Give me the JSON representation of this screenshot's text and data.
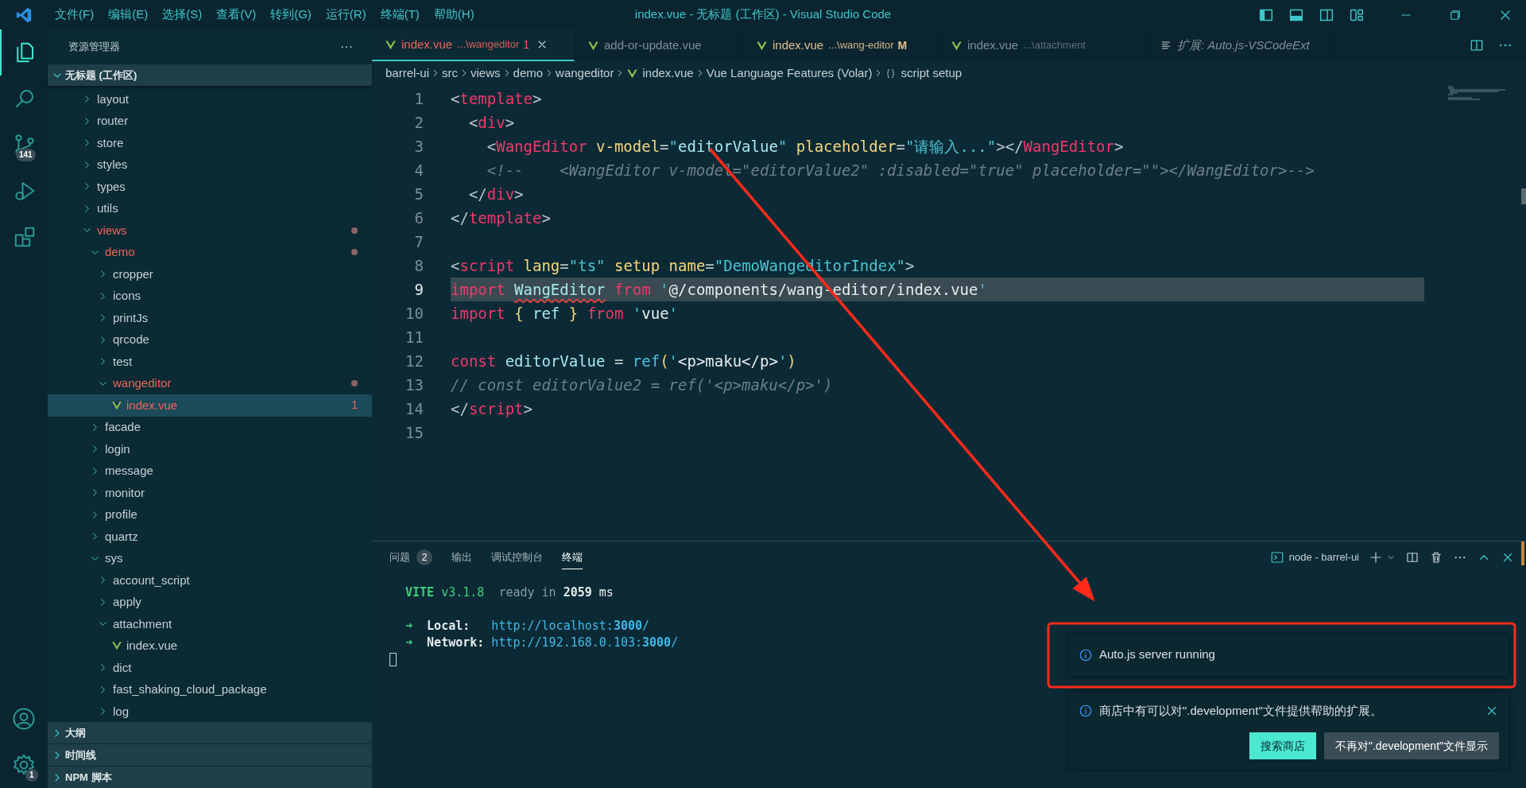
{
  "window": {
    "title": "index.vue - 无标题 (工作区) - Visual Studio Code"
  },
  "menu": [
    "文件(F)",
    "编辑(E)",
    "选择(S)",
    "查看(V)",
    "转到(G)",
    "运行(R)",
    "终端(T)",
    "帮助(H)"
  ],
  "activity_bar": [
    {
      "kind": "files",
      "selected": true
    },
    {
      "kind": "search",
      "selected": false
    },
    {
      "kind": "source-control",
      "selected": false,
      "badge": "141"
    },
    {
      "kind": "run",
      "selected": false
    },
    {
      "kind": "extensions",
      "selected": false
    }
  ],
  "activity_bar_bottom": [
    {
      "kind": "account"
    },
    {
      "kind": "settings",
      "badge": "1"
    }
  ],
  "sidebar": {
    "title": "资源管理器",
    "more": "···",
    "workspace": {
      "label": "无标题 (工作区)",
      "expanded": true
    },
    "tree": [
      {
        "label": "layout",
        "kind": "folder",
        "expanded": false,
        "modified": false,
        "selected": false
      },
      {
        "label": "router",
        "kind": "folder",
        "expanded": false,
        "modified": false,
        "selected": false
      },
      {
        "label": "store",
        "kind": "folder",
        "expanded": false,
        "modified": false,
        "selected": false
      },
      {
        "label": "styles",
        "kind": "folder",
        "expanded": false,
        "modified": false,
        "selected": false
      },
      {
        "label": "types",
        "kind": "folder",
        "expanded": false,
        "modified": false,
        "selected": false
      },
      {
        "label": "utils",
        "kind": "folder",
        "expanded": false,
        "modified": false,
        "selected": false
      },
      {
        "label": "views",
        "kind": "folder",
        "expanded": true,
        "modified": true,
        "selected": false,
        "children": [
          {
            "label": "demo",
            "kind": "folder",
            "expanded": true,
            "modified": true,
            "selected": false,
            "children": [
              {
                "label": "cropper",
                "kind": "folder",
                "expanded": false,
                "modified": false,
                "selected": false
              },
              {
                "label": "icons",
                "kind": "folder",
                "expanded": false,
                "modified": false,
                "selected": false
              },
              {
                "label": "printJs",
                "kind": "folder",
                "expanded": false,
                "modified": false,
                "selected": false
              },
              {
                "label": "qrcode",
                "kind": "folder",
                "expanded": false,
                "modified": false,
                "selected": false
              },
              {
                "label": "test",
                "kind": "folder",
                "expanded": false,
                "modified": false,
                "selected": false
              },
              {
                "label": "wangeditor",
                "kind": "folder",
                "expanded": true,
                "modified": true,
                "selected": false,
                "children": [
                  {
                    "label": "index.vue",
                    "kind": "vue",
                    "modified": true,
                    "selected": true,
                    "problems": "1"
                  }
                ]
              }
            ]
          },
          {
            "label": "facade",
            "kind": "folder",
            "expanded": false,
            "modified": false,
            "selected": false
          },
          {
            "label": "login",
            "kind": "folder",
            "expanded": false,
            "modified": false,
            "selected": false
          },
          {
            "label": "message",
            "kind": "folder",
            "expanded": false,
            "modified": false,
            "selected": false
          },
          {
            "label": "monitor",
            "kind": "folder",
            "expanded": false,
            "modified": false,
            "selected": false
          },
          {
            "label": "profile",
            "kind": "folder",
            "expanded": false,
            "modified": false,
            "selected": false
          },
          {
            "label": "quartz",
            "kind": "folder",
            "expanded": false,
            "modified": false,
            "selected": false
          },
          {
            "label": "sys",
            "kind": "folder",
            "expanded": true,
            "modified": false,
            "selected": false,
            "children": [
              {
                "label": "account_script",
                "kind": "folder",
                "expanded": false,
                "modified": false,
                "selected": false
              },
              {
                "label": "apply",
                "kind": "folder",
                "expanded": false,
                "modified": false,
                "selected": false
              },
              {
                "label": "attachment",
                "kind": "folder",
                "expanded": true,
                "modified": false,
                "selected": false,
                "children": [
                  {
                    "label": "index.vue",
                    "kind": "vue",
                    "modified": false,
                    "selected": false
                  }
                ]
              },
              {
                "label": "dict",
                "kind": "folder",
                "expanded": false,
                "modified": false,
                "selected": false
              },
              {
                "label": "fast_shaking_cloud_package",
                "kind": "folder",
                "expanded": false,
                "modified": false,
                "selected": false
              },
              {
                "label": "log",
                "kind": "folder",
                "expanded": false,
                "modified": false,
                "selected": false
              }
            ]
          }
        ]
      }
    ],
    "sections": [
      {
        "label": "大纲",
        "expanded": false
      },
      {
        "label": "时间线",
        "expanded": false
      },
      {
        "label": "NPM 脚本",
        "expanded": false
      }
    ]
  },
  "tabs": [
    {
      "name": "index.vue",
      "path": "...\\wangeditor",
      "status_letter": "1",
      "kind": "vue",
      "has_error": true,
      "modified": false,
      "selected": true,
      "preview": false
    },
    {
      "name": "add-or-update.vue",
      "kind": "vue",
      "has_error": false,
      "modified": false,
      "selected": false,
      "preview": false
    },
    {
      "name": "index.vue",
      "path": "...\\wang-editor",
      "status_letter": "M",
      "kind": "vue",
      "has_error": false,
      "modified": true,
      "selected": false,
      "preview": false
    },
    {
      "name": "index.vue",
      "path": "...\\attachment",
      "kind": "vue",
      "has_error": false,
      "modified": false,
      "selected": false,
      "preview": false
    },
    {
      "name": "扩展: Auto.js-VSCodeExt",
      "kind": "preview",
      "has_error": false,
      "modified": false,
      "selected": false,
      "preview": true
    }
  ],
  "breadcrumb": [
    {
      "label": "barrel-ui",
      "kind": "folder"
    },
    {
      "label": "src",
      "kind": "folder"
    },
    {
      "label": "views",
      "kind": "folder"
    },
    {
      "label": "demo",
      "kind": "folder"
    },
    {
      "label": "wangeditor",
      "kind": "folder"
    },
    {
      "label": "index.vue",
      "kind": "vue"
    },
    {
      "label": "Vue Language Features (Volar)",
      "kind": "folder"
    },
    {
      "label": "script setup",
      "kind": "symbol"
    }
  ],
  "code": [
    {
      "number": "1",
      "highlighted": false,
      "tokens": [
        {
          "text": "<",
          "kind": "punct"
        },
        {
          "text": "template",
          "kind": "tag"
        },
        {
          "text": ">",
          "kind": "punct"
        }
      ]
    },
    {
      "number": "2",
      "highlighted": false,
      "tokens": [
        {
          "text": "  <",
          "kind": "punct"
        },
        {
          "text": "div",
          "kind": "tag"
        },
        {
          "text": ">",
          "kind": "punct"
        }
      ]
    },
    {
      "number": "3",
      "highlighted": false,
      "tokens": [
        {
          "text": "    <",
          "kind": "punct"
        },
        {
          "text": "WangEditor",
          "kind": "tag"
        },
        {
          "text": " v-model",
          "kind": "attr"
        },
        {
          "text": "=",
          "kind": "punct"
        },
        {
          "text": "\"",
          "kind": "string"
        },
        {
          "text": "editorValue",
          "kind": "var"
        },
        {
          "text": "\"",
          "kind": "string"
        },
        {
          "text": " placeholder",
          "kind": "attr"
        },
        {
          "text": "=",
          "kind": "punct"
        },
        {
          "text": "\"请输入...\"",
          "kind": "string"
        },
        {
          "text": "></",
          "kind": "punct"
        },
        {
          "text": "WangEditor",
          "kind": "tag"
        },
        {
          "text": ">",
          "kind": "punct"
        }
      ]
    },
    {
      "number": "4",
      "highlighted": false,
      "tokens": [
        {
          "text": "    <!--    <WangEditor v-model=\"editorValue2\" :disabled=\"true\" placeholder=\"\"></WangEditor>-->",
          "kind": "comment"
        }
      ]
    },
    {
      "number": "5",
      "highlighted": false,
      "tokens": [
        {
          "text": "  </",
          "kind": "punct"
        },
        {
          "text": "div",
          "kind": "tag"
        },
        {
          "text": ">",
          "kind": "punct"
        }
      ]
    },
    {
      "number": "6",
      "highlighted": false,
      "tokens": [
        {
          "text": "</",
          "kind": "punct"
        },
        {
          "text": "template",
          "kind": "tag"
        },
        {
          "text": ">",
          "kind": "punct"
        }
      ]
    },
    {
      "number": "7",
      "highlighted": false
    },
    {
      "number": "8",
      "highlighted": false,
      "tokens": [
        {
          "text": "<",
          "kind": "punct"
        },
        {
          "text": "script",
          "kind": "tag"
        },
        {
          "text": " lang",
          "kind": "attr"
        },
        {
          "text": "=",
          "kind": "punct"
        },
        {
          "text": "\"ts\"",
          "kind": "string"
        },
        {
          "text": " setup",
          "kind": "attr"
        },
        {
          "text": " name",
          "kind": "attr"
        },
        {
          "text": "=",
          "kind": "punct"
        },
        {
          "text": "\"DemoWangeditorIndex\"",
          "kind": "string"
        },
        {
          "text": ">",
          "kind": "punct"
        }
      ]
    },
    {
      "number": "9",
      "highlighted": true,
      "tokens": [
        {
          "text": "import ",
          "kind": "keyword"
        },
        {
          "text": "WangEditor",
          "kind": "var",
          "error": true
        },
        {
          "text": " from",
          "kind": "keyword"
        },
        {
          "text": " '",
          "kind": "string"
        },
        {
          "text": "@/components/wang-editor/index.vue",
          "kind": "plain"
        },
        {
          "text": "'",
          "kind": "string"
        }
      ]
    },
    {
      "number": "10",
      "highlighted": false,
      "tokens": [
        {
          "text": "import",
          "kind": "keyword"
        },
        {
          "text": " {",
          "kind": "brace"
        },
        {
          "text": " ref",
          "kind": "var"
        },
        {
          "text": " }",
          "kind": "brace"
        },
        {
          "text": " from",
          "kind": "keyword"
        },
        {
          "text": " '",
          "kind": "string"
        },
        {
          "text": "vue",
          "kind": "plain"
        },
        {
          "text": "'",
          "kind": "string"
        }
      ]
    },
    {
      "number": "11",
      "highlighted": false
    },
    {
      "number": "12",
      "highlighted": false,
      "tokens": [
        {
          "text": "const",
          "kind": "keyword"
        },
        {
          "text": " editorValue",
          "kind": "var"
        },
        {
          "text": " = ",
          "kind": "punct"
        },
        {
          "text": "ref",
          "kind": "func"
        },
        {
          "text": "(",
          "kind": "brace"
        },
        {
          "text": "'",
          "kind": "string"
        },
        {
          "text": "<p>maku</p>",
          "kind": "plain"
        },
        {
          "text": "'",
          "kind": "string"
        },
        {
          "text": ")",
          "kind": "brace"
        }
      ]
    },
    {
      "number": "13",
      "highlighted": false,
      "tokens": [
        {
          "text": "// const editorValue2 = ref('<p>maku</p>')",
          "kind": "comment"
        }
      ]
    },
    {
      "number": "14",
      "highlighted": false,
      "tokens": [
        {
          "text": "</",
          "kind": "punct"
        },
        {
          "text": "script",
          "kind": "tag"
        },
        {
          "text": ">",
          "kind": "punct"
        }
      ]
    },
    {
      "number": "15",
      "highlighted": false
    }
  ],
  "panel": {
    "tabs": [
      {
        "label": "问题",
        "badge": "2",
        "selected": false
      },
      {
        "label": "输出",
        "selected": false
      },
      {
        "label": "调试控制台",
        "selected": false
      },
      {
        "label": "终端",
        "selected": true
      }
    ],
    "terminal_name": "node - barrel-ui",
    "terminal": [
      [
        {
          "text": "VITE",
          "kind": "green-bold"
        },
        {
          "text": " v3.1.8",
          "kind": "green"
        },
        {
          "text": "  ready in ",
          "kind": "dim"
        },
        {
          "text": "2059",
          "kind": "bold"
        },
        {
          "text": " ms",
          "kind": "plain"
        }
      ],
      [
        {
          "text": "➜",
          "kind": "green"
        },
        {
          "text": "  Local:",
          "kind": "bold"
        },
        {
          "text": "   http://localhost:",
          "kind": "cyan"
        },
        {
          "text": "3000",
          "kind": "cyan-bold"
        },
        {
          "text": "/",
          "kind": "cyan"
        }
      ],
      [
        {
          "text": "➜",
          "kind": "green"
        },
        {
          "text": "  Network:",
          "kind": "bold"
        },
        {
          "text": " http://192.168.0.103:",
          "kind": "cyan"
        },
        {
          "text": "3000",
          "kind": "cyan-bold"
        },
        {
          "text": "/",
          "kind": "cyan"
        }
      ]
    ]
  },
  "notifications": [
    {
      "message": "Auto.js server running"
    },
    {
      "message": "商店中有可以对\".development\"文件提供帮助的扩展。",
      "closable": true,
      "buttons": [
        {
          "label": "搜索商店",
          "primary": true
        },
        {
          "label": "不再对\".development\"文件显示",
          "primary": false
        }
      ]
    }
  ]
}
